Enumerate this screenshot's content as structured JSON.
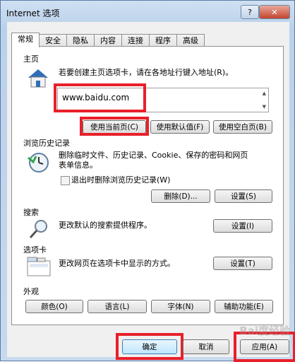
{
  "window": {
    "title": "Internet 选项",
    "help": "?",
    "close": "✕"
  },
  "tabs": [
    "常规",
    "安全",
    "隐私",
    "内容",
    "连接",
    "程序",
    "高级"
  ],
  "homepage": {
    "section": "主页",
    "hint": "若要创建主页选项卡，请在各地址行键入地址(R)。",
    "url": "www.baidu.com",
    "btn_current": "使用当前页(C)",
    "btn_default": "使用默认值(F)",
    "btn_blank": "使用空白页(B)"
  },
  "history": {
    "section": "浏览历史记录",
    "text1": "删除临时文件、历史记录、Cookie、保存的密码和网页",
    "text2": "表单信息。",
    "checkbox": "退出时删除浏览历史记录(W)",
    "btn_delete": "删除(D)...",
    "btn_settings": "设置(S)"
  },
  "search": {
    "section": "搜索",
    "text": "更改默认的搜索提供程序。",
    "btn_settings": "设置(I)"
  },
  "tabsec": {
    "section": "选项卡",
    "text": "更改网页在选项卡中显示的方式。",
    "btn_settings": "设置(T)"
  },
  "appearance": {
    "section": "外观",
    "colors": "颜色(O)",
    "languages": "语言(L)",
    "fonts": "字体(N)",
    "accessibility": "辅助功能(E)"
  },
  "footer": {
    "ok": "确定",
    "cancel": "取消",
    "apply": "应用(A)"
  },
  "watermark": "Bai度经验",
  "colors": {
    "highlight": "#e8202a"
  }
}
